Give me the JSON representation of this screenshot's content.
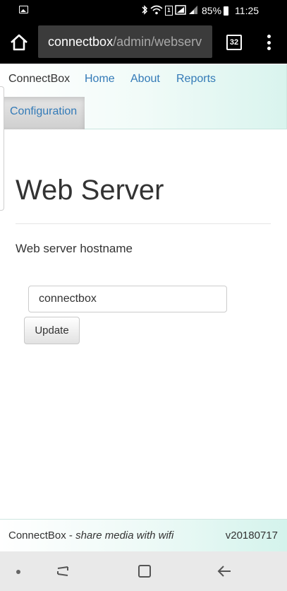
{
  "status_bar": {
    "battery_percent": "85%",
    "time": "11:25",
    "sim_slot": "1"
  },
  "browser": {
    "url_host": "connectbox",
    "url_path": "/admin/webserv",
    "tab_count": "32"
  },
  "navbar": {
    "brand": "ConnectBox",
    "links": [
      "Home",
      "About",
      "Reports"
    ],
    "active": "Configuration"
  },
  "main": {
    "title": "Web Server",
    "field_label": "Web server hostname",
    "hostname_value": "connectbox",
    "update_label": "Update"
  },
  "footer": {
    "brand": "ConnectBox",
    "separator": " - ",
    "tagline": "share media with wifi",
    "version": "v20180717"
  },
  "icons": [
    "gallery-icon",
    "bluetooth-icon",
    "wifi-icon",
    "signal-icon",
    "battery-icon",
    "home-icon",
    "tabs-icon",
    "more-icon",
    "recents-icon",
    "overview-icon",
    "back-icon"
  ],
  "colors": {
    "link": "#337ab7",
    "text": "#333333",
    "nav_gradient_end": "#d9f4ee",
    "browser_bar": "#000000",
    "url_box": "#3b3b3b"
  }
}
